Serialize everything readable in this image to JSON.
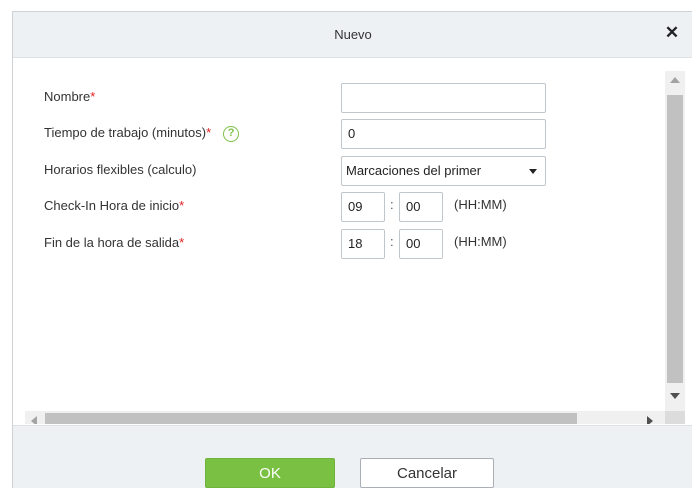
{
  "dialog": {
    "title": "Nuevo",
    "close_glyph": "✕"
  },
  "form": {
    "nombre": {
      "label": "Nombre",
      "required": "*",
      "value": ""
    },
    "tiempo": {
      "label": "Tiempo de trabajo (minutos)",
      "required": "*",
      "help_glyph": "?",
      "value": "0"
    },
    "horarios": {
      "label": "Horarios flexibles (calculo)",
      "selected": "Marcaciones del primer"
    },
    "checkin": {
      "label": "Check-In Hora de inicio",
      "required": "*",
      "hour": "09",
      "minute": "00",
      "separator": ":",
      "format": "(HH:MM)"
    },
    "fin": {
      "label": "Fin de la hora de salida",
      "required": "*",
      "hour": "18",
      "minute": "00",
      "separator": ":",
      "format": "(HH:MM)"
    }
  },
  "footer": {
    "ok_label": "OK",
    "cancel_label": "Cancelar"
  },
  "colors": {
    "ok_green": "#7ac143",
    "required_red": "#e02020",
    "help_green": "#7ec24a",
    "titlebar_bg": "#eef1f4"
  },
  "icons": {
    "close": "close-icon",
    "help": "question-circle-icon",
    "dropdown": "caret-down-icon"
  }
}
